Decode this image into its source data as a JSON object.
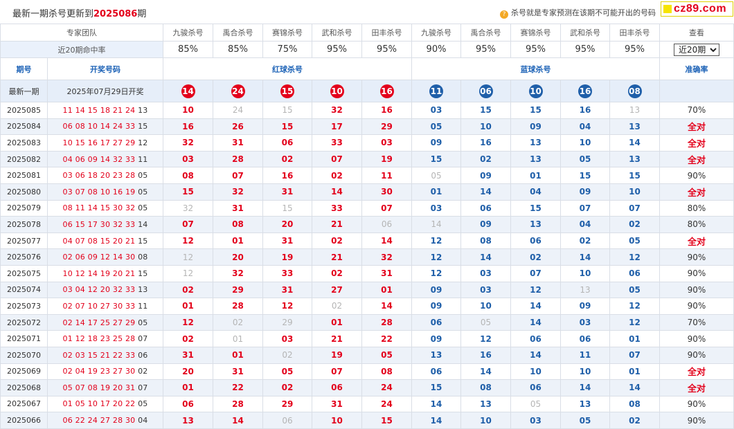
{
  "header": {
    "title_prefix": "最新一期杀号更新到",
    "title_issue": "2025086",
    "title_suffix": "期",
    "hint_icon": "?",
    "hint": "杀号就是专家预测在该期不可能开出的号码",
    "logo_text": "cz89.com"
  },
  "experts_label": "专家团队",
  "experts": [
    "九骏杀号",
    "禹合杀号",
    "赛锦杀号",
    "武和杀号",
    "田丰杀号",
    "九骏杀号",
    "禹合杀号",
    "赛锦杀号",
    "武和杀号",
    "田丰杀号"
  ],
  "view_label": "查看",
  "rate_label": "近20期命中率",
  "rates": [
    "85%",
    "85%",
    "75%",
    "95%",
    "95%",
    "90%",
    "95%",
    "95%",
    "95%",
    "95%"
  ],
  "period_select": {
    "selected": "近20期"
  },
  "columns": {
    "issue": "期号",
    "draw": "开奖号码",
    "red": "红球杀号",
    "blue": "蓝球杀号",
    "accuracy": "准确率"
  },
  "latest": {
    "label": "最新一期",
    "draw_date": "2025年07月29日开奖",
    "red_kills": [
      "14",
      "24",
      "15",
      "10",
      "16"
    ],
    "blue_kills": [
      "11",
      "06",
      "10",
      "16",
      "08"
    ]
  },
  "colors": {
    "red": "#e3001b",
    "blue": "#1f5fa9",
    "miss": "#b5b5b5",
    "header_text": "#1e63b7"
  },
  "rows": [
    {
      "issue": "2025085",
      "red_draw": "11 14 15 18 21 24",
      "blue_draw": "13",
      "red_kills": [
        "10",
        "24",
        "15",
        "32",
        "16"
      ],
      "red_miss": [
        false,
        true,
        true,
        false,
        false
      ],
      "blue_kills": [
        "03",
        "15",
        "15",
        "16",
        "13"
      ],
      "blue_miss": [
        false,
        false,
        false,
        false,
        true
      ],
      "accuracy": "70%",
      "full": false
    },
    {
      "issue": "2025084",
      "red_draw": "06 08 10 14 24 33",
      "blue_draw": "15",
      "red_kills": [
        "16",
        "26",
        "15",
        "17",
        "29"
      ],
      "red_miss": [
        false,
        false,
        false,
        false,
        false
      ],
      "blue_kills": [
        "05",
        "10",
        "09",
        "04",
        "13"
      ],
      "blue_miss": [
        false,
        false,
        false,
        false,
        false
      ],
      "accuracy": "全对",
      "full": true
    },
    {
      "issue": "2025083",
      "red_draw": "10 15 16 17 27 29",
      "blue_draw": "12",
      "red_kills": [
        "32",
        "31",
        "06",
        "33",
        "03"
      ],
      "red_miss": [
        false,
        false,
        false,
        false,
        false
      ],
      "blue_kills": [
        "09",
        "16",
        "13",
        "10",
        "14"
      ],
      "blue_miss": [
        false,
        false,
        false,
        false,
        false
      ],
      "accuracy": "全对",
      "full": true
    },
    {
      "issue": "2025082",
      "red_draw": "04 06 09 14 32 33",
      "blue_draw": "11",
      "red_kills": [
        "03",
        "28",
        "02",
        "07",
        "19"
      ],
      "red_miss": [
        false,
        false,
        false,
        false,
        false
      ],
      "blue_kills": [
        "15",
        "02",
        "13",
        "05",
        "13"
      ],
      "blue_miss": [
        false,
        false,
        false,
        false,
        false
      ],
      "accuracy": "全对",
      "full": true
    },
    {
      "issue": "2025081",
      "red_draw": "03 06 18 20 23 28",
      "blue_draw": "05",
      "red_kills": [
        "08",
        "07",
        "16",
        "02",
        "11"
      ],
      "red_miss": [
        false,
        false,
        false,
        false,
        false
      ],
      "blue_kills": [
        "05",
        "09",
        "01",
        "15",
        "15"
      ],
      "blue_miss": [
        true,
        false,
        false,
        false,
        false
      ],
      "accuracy": "90%",
      "full": false
    },
    {
      "issue": "2025080",
      "red_draw": "03 07 08 10 16 19",
      "blue_draw": "05",
      "red_kills": [
        "15",
        "32",
        "31",
        "14",
        "30"
      ],
      "red_miss": [
        false,
        false,
        false,
        false,
        false
      ],
      "blue_kills": [
        "01",
        "14",
        "04",
        "09",
        "10"
      ],
      "blue_miss": [
        false,
        false,
        false,
        false,
        false
      ],
      "accuracy": "全对",
      "full": true
    },
    {
      "issue": "2025079",
      "red_draw": "08 11 14 15 30 32",
      "blue_draw": "05",
      "red_kills": [
        "32",
        "31",
        "15",
        "33",
        "07"
      ],
      "red_miss": [
        true,
        false,
        true,
        false,
        false
      ],
      "blue_kills": [
        "03",
        "06",
        "15",
        "07",
        "07"
      ],
      "blue_miss": [
        false,
        false,
        false,
        false,
        false
      ],
      "accuracy": "80%",
      "full": false
    },
    {
      "issue": "2025078",
      "red_draw": "06 15 17 30 32 33",
      "blue_draw": "14",
      "red_kills": [
        "07",
        "08",
        "20",
        "21",
        "06"
      ],
      "red_miss": [
        false,
        false,
        false,
        false,
        true
      ],
      "blue_kills": [
        "14",
        "09",
        "13",
        "04",
        "02"
      ],
      "blue_miss": [
        true,
        false,
        false,
        false,
        false
      ],
      "accuracy": "80%",
      "full": false
    },
    {
      "issue": "2025077",
      "red_draw": "04 07 08 15 20 21",
      "blue_draw": "15",
      "red_kills": [
        "12",
        "01",
        "31",
        "02",
        "14"
      ],
      "red_miss": [
        false,
        false,
        false,
        false,
        false
      ],
      "blue_kills": [
        "12",
        "08",
        "06",
        "02",
        "05"
      ],
      "blue_miss": [
        false,
        false,
        false,
        false,
        false
      ],
      "accuracy": "全对",
      "full": true
    },
    {
      "issue": "2025076",
      "red_draw": "02 06 09 12 14 30",
      "blue_draw": "08",
      "red_kills": [
        "12",
        "20",
        "19",
        "21",
        "32"
      ],
      "red_miss": [
        true,
        false,
        false,
        false,
        false
      ],
      "blue_kills": [
        "12",
        "14",
        "02",
        "14",
        "12"
      ],
      "blue_miss": [
        false,
        false,
        false,
        false,
        false
      ],
      "accuracy": "90%",
      "full": false
    },
    {
      "issue": "2025075",
      "red_draw": "10 12 14 19 20 21",
      "blue_draw": "15",
      "red_kills": [
        "12",
        "32",
        "33",
        "02",
        "31"
      ],
      "red_miss": [
        true,
        false,
        false,
        false,
        false
      ],
      "blue_kills": [
        "12",
        "03",
        "07",
        "10",
        "06"
      ],
      "blue_miss": [
        false,
        false,
        false,
        false,
        false
      ],
      "accuracy": "90%",
      "full": false
    },
    {
      "issue": "2025074",
      "red_draw": "03 04 12 20 32 33",
      "blue_draw": "13",
      "red_kills": [
        "02",
        "29",
        "31",
        "27",
        "01"
      ],
      "red_miss": [
        false,
        false,
        false,
        false,
        false
      ],
      "blue_kills": [
        "09",
        "03",
        "12",
        "13",
        "05"
      ],
      "blue_miss": [
        false,
        false,
        false,
        true,
        false
      ],
      "accuracy": "90%",
      "full": false
    },
    {
      "issue": "2025073",
      "red_draw": "02 07 10 27 30 33",
      "blue_draw": "11",
      "red_kills": [
        "01",
        "28",
        "12",
        "02",
        "14"
      ],
      "red_miss": [
        false,
        false,
        false,
        true,
        false
      ],
      "blue_kills": [
        "09",
        "10",
        "14",
        "09",
        "12"
      ],
      "blue_miss": [
        false,
        false,
        false,
        false,
        false
      ],
      "accuracy": "90%",
      "full": false
    },
    {
      "issue": "2025072",
      "red_draw": "02 14 17 25 27 29",
      "blue_draw": "05",
      "red_kills": [
        "12",
        "02",
        "29",
        "01",
        "28"
      ],
      "red_miss": [
        false,
        true,
        true,
        false,
        false
      ],
      "blue_kills": [
        "06",
        "05",
        "14",
        "03",
        "12"
      ],
      "blue_miss": [
        false,
        true,
        false,
        false,
        false
      ],
      "accuracy": "70%",
      "full": false
    },
    {
      "issue": "2025071",
      "red_draw": "01 12 18 23 25 28",
      "blue_draw": "07",
      "red_kills": [
        "02",
        "01",
        "03",
        "21",
        "22"
      ],
      "red_miss": [
        false,
        true,
        false,
        false,
        false
      ],
      "blue_kills": [
        "09",
        "12",
        "06",
        "06",
        "01"
      ],
      "blue_miss": [
        false,
        false,
        false,
        false,
        false
      ],
      "accuracy": "90%",
      "full": false
    },
    {
      "issue": "2025070",
      "red_draw": "02 03 15 21 22 33",
      "blue_draw": "06",
      "red_kills": [
        "31",
        "01",
        "02",
        "19",
        "05"
      ],
      "red_miss": [
        false,
        false,
        true,
        false,
        false
      ],
      "blue_kills": [
        "13",
        "16",
        "14",
        "11",
        "07"
      ],
      "blue_miss": [
        false,
        false,
        false,
        false,
        false
      ],
      "accuracy": "90%",
      "full": false
    },
    {
      "issue": "2025069",
      "red_draw": "02 04 19 23 27 30",
      "blue_draw": "02",
      "red_kills": [
        "20",
        "31",
        "05",
        "07",
        "08"
      ],
      "red_miss": [
        false,
        false,
        false,
        false,
        false
      ],
      "blue_kills": [
        "06",
        "14",
        "10",
        "10",
        "01"
      ],
      "blue_miss": [
        false,
        false,
        false,
        false,
        false
      ],
      "accuracy": "全对",
      "full": true
    },
    {
      "issue": "2025068",
      "red_draw": "05 07 08 19 20 31",
      "blue_draw": "07",
      "red_kills": [
        "01",
        "22",
        "02",
        "06",
        "24"
      ],
      "red_miss": [
        false,
        false,
        false,
        false,
        false
      ],
      "blue_kills": [
        "15",
        "08",
        "06",
        "14",
        "14"
      ],
      "blue_miss": [
        false,
        false,
        false,
        false,
        false
      ],
      "accuracy": "全对",
      "full": true
    },
    {
      "issue": "2025067",
      "red_draw": "01 05 10 17 20 22",
      "blue_draw": "05",
      "red_kills": [
        "06",
        "28",
        "29",
        "31",
        "24"
      ],
      "red_miss": [
        false,
        false,
        false,
        false,
        false
      ],
      "blue_kills": [
        "14",
        "13",
        "05",
        "13",
        "08"
      ],
      "blue_miss": [
        false,
        false,
        true,
        false,
        false
      ],
      "accuracy": "90%",
      "full": false
    },
    {
      "issue": "2025066",
      "red_draw": "06 22 24 27 28 30",
      "blue_draw": "04",
      "red_kills": [
        "13",
        "14",
        "06",
        "10",
        "15"
      ],
      "red_miss": [
        false,
        false,
        true,
        false,
        false
      ],
      "blue_kills": [
        "14",
        "10",
        "03",
        "05",
        "02"
      ],
      "blue_miss": [
        false,
        false,
        false,
        false,
        false
      ],
      "accuracy": "90%",
      "full": false
    }
  ]
}
